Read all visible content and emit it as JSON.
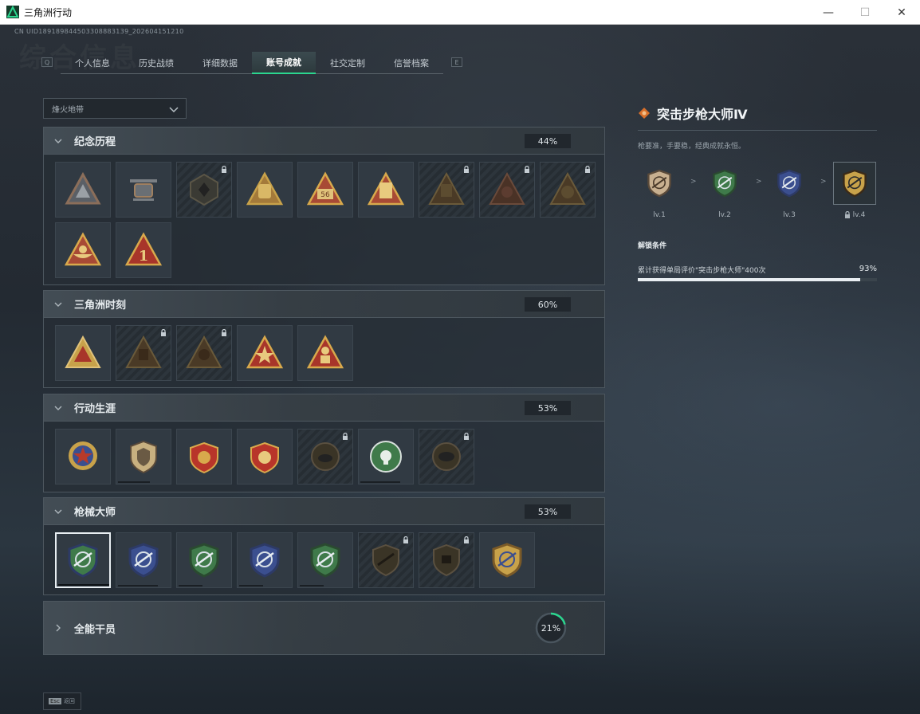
{
  "window": {
    "title": "三角洲行动",
    "minimize": "—",
    "maximize": "☐",
    "close": "✕"
  },
  "uid": "CN UID189189844503308883139_202604151210",
  "ghost_heading": "综合信息",
  "tabs": {
    "left_key": "Q",
    "right_key": "E",
    "items": [
      {
        "label": "个人信息"
      },
      {
        "label": "历史战绩"
      },
      {
        "label": "详细数据"
      },
      {
        "label": "账号成就",
        "active": true
      },
      {
        "label": "社交定制"
      },
      {
        "label": "信誉档案"
      }
    ]
  },
  "filter": {
    "value": "烽火地带"
  },
  "sections": [
    {
      "title": "纪念历程",
      "percent": "44%"
    },
    {
      "title": "三角洲时刻",
      "percent": "60%"
    },
    {
      "title": "行动生涯",
      "percent": "53%"
    },
    {
      "title": "枪械大师",
      "percent": "53%"
    },
    {
      "title": "全能干员",
      "percent": "21%",
      "percent_value": 0.21
    }
  ],
  "detail": {
    "title": "突击步枪大师Ⅳ",
    "description": "枪要准，手要稳，经典成就永恒。",
    "levels": [
      {
        "label": "lv.1"
      },
      {
        "label": "lv.2"
      },
      {
        "label": "lv.3"
      },
      {
        "label": "lv.4",
        "locked": true
      }
    ],
    "separator": ">",
    "unlock_heading": "解锁条件",
    "condition": "累计获得单局评价\"突击步枪大师\"400次",
    "condition_percent": "93%",
    "condition_value": 0.93
  },
  "footer": {
    "key": "Esc",
    "label": "返回"
  },
  "colors": {
    "accent": "#2bd68f",
    "gold": "#c8a24a",
    "green_badge": "#3f7a4a",
    "blue_badge": "#3b4f8f"
  }
}
